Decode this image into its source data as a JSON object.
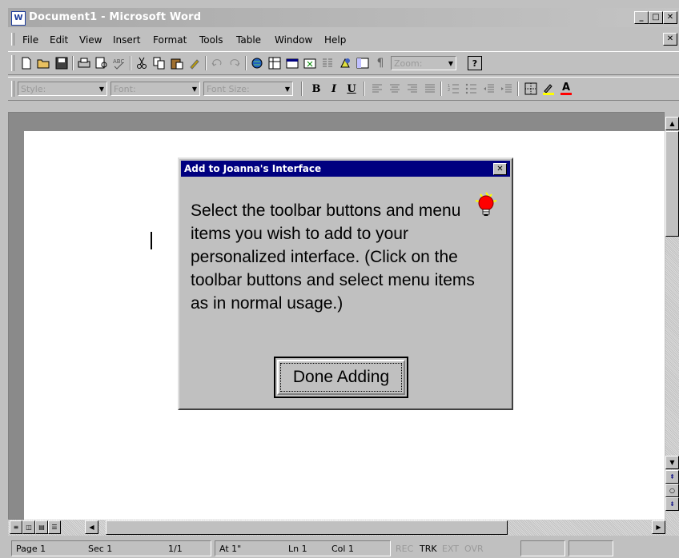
{
  "window": {
    "title": "Document1 - Microsoft Word"
  },
  "menubar": {
    "items": [
      {
        "label": "File"
      },
      {
        "label": "Edit"
      },
      {
        "label": "View"
      },
      {
        "label": "Insert"
      },
      {
        "label": "Format"
      },
      {
        "label": "Tools"
      },
      {
        "label": "Table"
      },
      {
        "label": "Window"
      },
      {
        "label": "Help"
      }
    ]
  },
  "standard_toolbar": {
    "zoom_placeholder": "Zoom:",
    "icons": [
      "new-icon",
      "open-icon",
      "save-icon",
      "print-icon",
      "print-preview-icon",
      "spelling-icon",
      "cut-icon",
      "copy-icon",
      "paste-icon",
      "format-painter-icon",
      "undo-icon",
      "redo-icon",
      "web-toolbar-icon",
      "tables-borders-icon",
      "insert-table-icon",
      "insert-excel-icon",
      "columns-icon",
      "drawing-icon",
      "document-map-icon",
      "show-formatting-icon",
      "help-icon"
    ]
  },
  "formatting_toolbar": {
    "style_placeholder": "Style:",
    "font_placeholder": "Font:",
    "font_size_placeholder": "Font Size:",
    "bold_label": "B",
    "italic_label": "I",
    "underline_label": "U",
    "highlight_label": "",
    "font_color_label": "A"
  },
  "dialog": {
    "title": "Add to Joanna's Interface",
    "message": "Select the toolbar buttons and menu items you wish to add to your personalized interface. (Click on the toolbar buttons and select menu items as in normal usage.)",
    "done_button": "Done Adding"
  },
  "statusbar": {
    "page": "Page 1",
    "section": "Sec 1",
    "pages": "1/1",
    "at": "At 1\"",
    "line": "Ln 1",
    "col": "Col 1",
    "indicators": [
      "REC",
      "TRK",
      "EXT",
      "OVR"
    ]
  },
  "colors": {
    "dialog_title_bg": "#000080",
    "window_title_bg": "#a8a8a8",
    "font_color_red": "#ff0000"
  }
}
